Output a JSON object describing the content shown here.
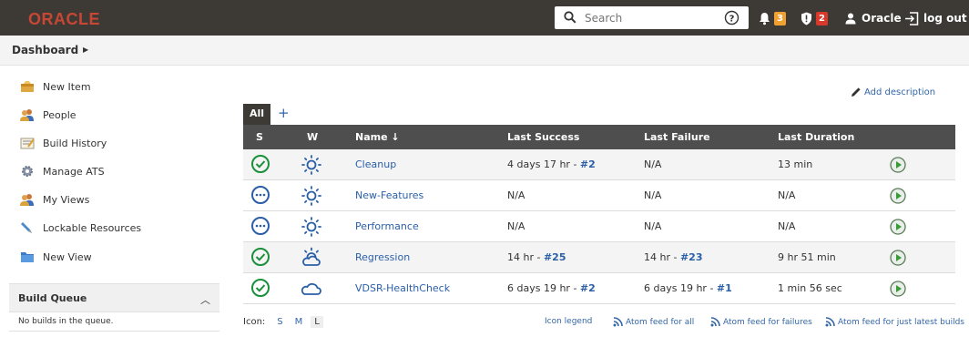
{
  "topbar": {
    "brand": "ORACLE",
    "search_placeholder": "Search",
    "notifications_count": "3",
    "security_count": "2",
    "user_name": "Oracle",
    "logout_label": "log out",
    "colors": {
      "bar": "#3d3a36",
      "brand": "#c74634",
      "warn_badge": "#f0a030",
      "alert_badge": "#d9392b"
    }
  },
  "breadcrumb": {
    "root": "Dashboard"
  },
  "sidebar": {
    "items": [
      {
        "label": "New Item",
        "icon": "new-item-icon"
      },
      {
        "label": "People",
        "icon": "people-icon"
      },
      {
        "label": "Build History",
        "icon": "build-history-icon"
      },
      {
        "label": "Manage ATS",
        "icon": "gear-icon"
      },
      {
        "label": "My Views",
        "icon": "people-icon"
      },
      {
        "label": "Lockable Resources",
        "icon": "lock-resource-icon"
      },
      {
        "label": "New View",
        "icon": "folder-icon"
      }
    ],
    "build_queue": {
      "title": "Build Queue",
      "empty_text": "No builds in the queue."
    }
  },
  "main": {
    "add_description": "Add description",
    "tabs": [
      {
        "label": "All"
      }
    ],
    "add_tab": "+",
    "columns": [
      "S",
      "W",
      "Name ↓",
      "Last Success",
      "Last Failure",
      "Last Duration"
    ],
    "rows": [
      {
        "status": "success",
        "weather": "sunny",
        "name": "Cleanup",
        "success_text": "4 days 17 hr - ",
        "success_build": "#2",
        "failure_text": "N/A",
        "failure_build": "",
        "duration": "13 min"
      },
      {
        "status": "notbuilt",
        "weather": "sunny",
        "name": "New-Features",
        "success_text": "N/A",
        "success_build": "",
        "failure_text": "N/A",
        "failure_build": "",
        "duration": "N/A"
      },
      {
        "status": "notbuilt",
        "weather": "sunny",
        "name": "Performance",
        "success_text": "N/A",
        "success_build": "",
        "failure_text": "N/A",
        "failure_build": "",
        "duration": "N/A"
      },
      {
        "status": "success",
        "weather": "partly-cloudy",
        "name": "Regression",
        "success_text": "14 hr - ",
        "success_build": "#25",
        "failure_text": "14 hr - ",
        "failure_build": "#23",
        "duration": "9 hr 51 min"
      },
      {
        "status": "success",
        "weather": "cloudy",
        "name": "VDSR-HealthCheck",
        "success_text": "6 days 19 hr - ",
        "success_build": "#2",
        "failure_text": "6 days 19 hr - ",
        "failure_build": "#1",
        "duration": "1 min 56 sec"
      }
    ],
    "footer": {
      "icon_label": "Icon:",
      "sizes": [
        "S",
        "M",
        "L"
      ],
      "selected_size": "L",
      "icon_legend": "Icon legend",
      "feed_all": "Atom feed for all",
      "feed_failures": "Atom feed for failures",
      "feed_latest": "Atom feed for just latest builds"
    },
    "colors": {
      "header": "#4e4e4e",
      "link": "#2a5fa8",
      "success": "#1a8f3c",
      "notbuilt": "#2a5fa8"
    }
  }
}
